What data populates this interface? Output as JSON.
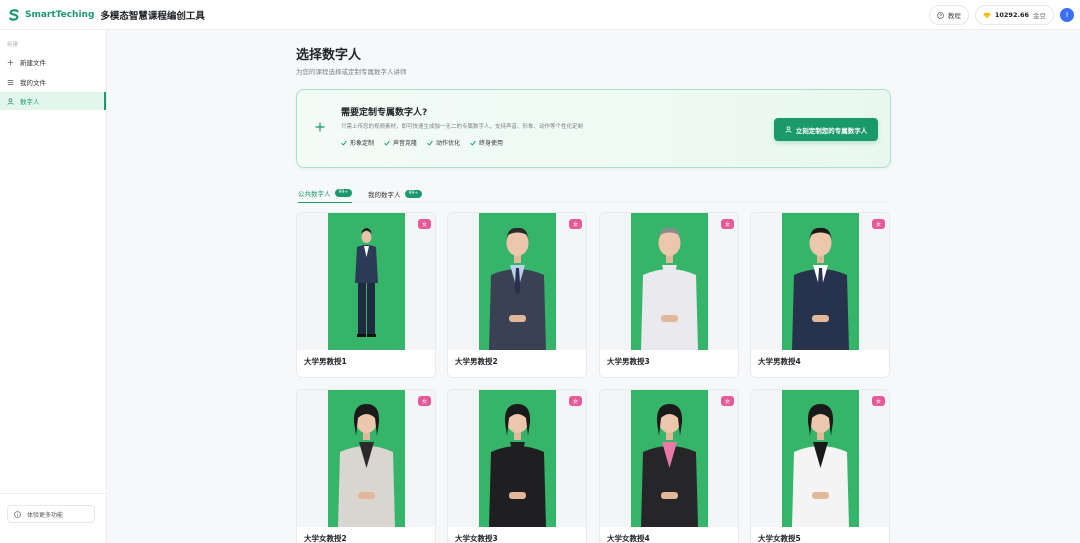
{
  "header": {
    "brand": "SmartTeching",
    "app_title": "多模态智慧课程编创工具",
    "tutorial_label": "教程",
    "credits_value": "10292.66",
    "credits_unit": "金豆",
    "avatar_letter": "I"
  },
  "sidebar": {
    "section_label": "新建",
    "items": [
      {
        "label": "新建文件",
        "icon": "plus-icon"
      },
      {
        "label": "我的文件",
        "icon": "list-icon"
      },
      {
        "label": "数字人",
        "icon": "user-icon",
        "active": true
      }
    ],
    "bottom_label": "体验更多功能"
  },
  "main": {
    "title": "选择数字人",
    "subtitle": "为您的课程选择或定制专属数字人讲师"
  },
  "banner": {
    "title": "需要定制专属数字人?",
    "description": "只需上传您的视频素材，即可快速生成独一无二的专属数字人，支持声音、形象、动作等个性化定制",
    "tags": [
      "形象定制",
      "声音克隆",
      "动作优化",
      "终身使用"
    ],
    "cta_label": "立刻定制您的专属数字人"
  },
  "tabs": [
    {
      "label": "公共数字人",
      "badge": "99+",
      "active": true
    },
    {
      "label": "我的数字人",
      "badge": "99+",
      "active": false
    }
  ],
  "cards": [
    {
      "name": "大学男教授1",
      "gender": "女",
      "suit": "#2b3a55",
      "shirt": "#ffffff",
      "pants": "#1f2a40",
      "hair": "#1a1a1a"
    },
    {
      "name": "大学男教授2",
      "gender": "女",
      "suit": "#3a4152",
      "shirt": "#b9d1ec",
      "pants": "#3a4152",
      "hair": "#2a2a2a"
    },
    {
      "name": "大学男教授3",
      "gender": "女",
      "suit": "#e9e9ee",
      "shirt": "#e9e9ee",
      "pants": "#8e8e8a",
      "hair": "#8b8b8b"
    },
    {
      "name": "大学男教授4",
      "gender": "女",
      "suit": "#27334d",
      "shirt": "#ffffff",
      "pants": "#27334d",
      "hair": "#1a1a1a"
    },
    {
      "name": "大学女教授2",
      "gender": "女",
      "suit": "#d8d6cf",
      "shirt": "#2a2a2a",
      "pants": "#d8d6cf",
      "hair": "#1a1a1a"
    },
    {
      "name": "大学女教授3",
      "gender": "女",
      "suit": "#1f1f22",
      "shirt": "#1f1f22",
      "pants": "#1f1f22",
      "hair": "#1a1a1a"
    },
    {
      "name": "大学女教授4",
      "gender": "女",
      "suit": "#262629",
      "shirt": "#e87aa8",
      "pants": "#555860",
      "hair": "#1a1a1a"
    },
    {
      "name": "大学女教授5",
      "gender": "女",
      "suit": "#f4f4f4",
      "shirt": "#1a1a1a",
      "pants": "#f4f4f4",
      "hair": "#1a1a1a"
    }
  ]
}
